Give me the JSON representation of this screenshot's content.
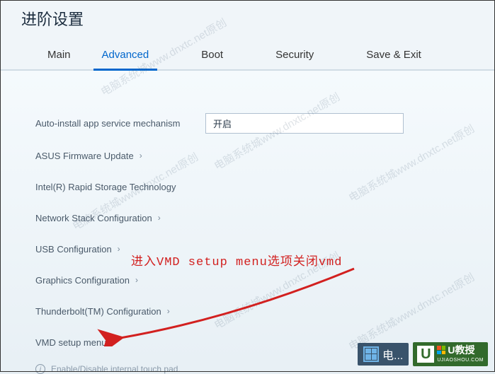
{
  "title": "进阶设置",
  "tabs": {
    "main": "Main",
    "advanced": "Advanced",
    "boot": "Boot",
    "security": "Security",
    "save_exit": "Save & Exit"
  },
  "settings": {
    "auto_install": {
      "label": "Auto-install app service mechanism",
      "value": "开启"
    },
    "asus_fw": "ASUS Firmware Update",
    "intel_rst": "Intel(R) Rapid Storage Technology",
    "net_stack": "Network Stack Configuration",
    "usb": "USB Configuration",
    "graphics": "Graphics Configuration",
    "thunderbolt": "Thunderbolt(TM) Configuration",
    "vmd": "VMD setup menu"
  },
  "help_text": "Enable/Disable internal touch pad.",
  "annotation": "进入VMD setup menu选项关闭vmd",
  "watermark_text": "电脑系统城www.dnxtc.net原创",
  "logos": {
    "site1": "电...",
    "site2_brand": "U教授",
    "site2_url": "UJIAOSHOU.COM"
  }
}
